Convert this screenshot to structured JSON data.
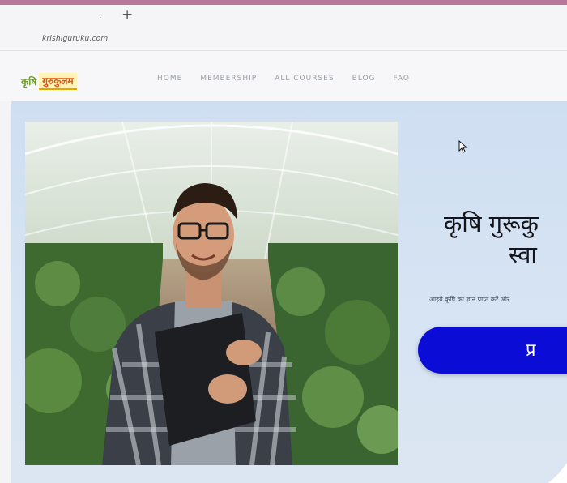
{
  "browser": {
    "tab_dot": "·",
    "new_tab_symbol": "+",
    "url": "krishiguruku.com"
  },
  "site": {
    "logo_part1": "कृषि",
    "logo_part2": "गुरुकुलम"
  },
  "nav": {
    "items": [
      {
        "label": "HOME"
      },
      {
        "label": "MEMBERSHIP"
      },
      {
        "label": "ALL COURSES"
      },
      {
        "label": "BLOG"
      },
      {
        "label": "FAQ"
      }
    ]
  },
  "hero": {
    "title_line1": "कृषि गुरूकु",
    "title_line2": "स्वा",
    "subtitle": "आइये कृषि का ज्ञान प्राप्त करें और",
    "cta_label": "प्र"
  },
  "colors": {
    "cta": "#0b0dd6",
    "accent_strip": "#b7789c",
    "hero_bg": "#cfdff2"
  }
}
